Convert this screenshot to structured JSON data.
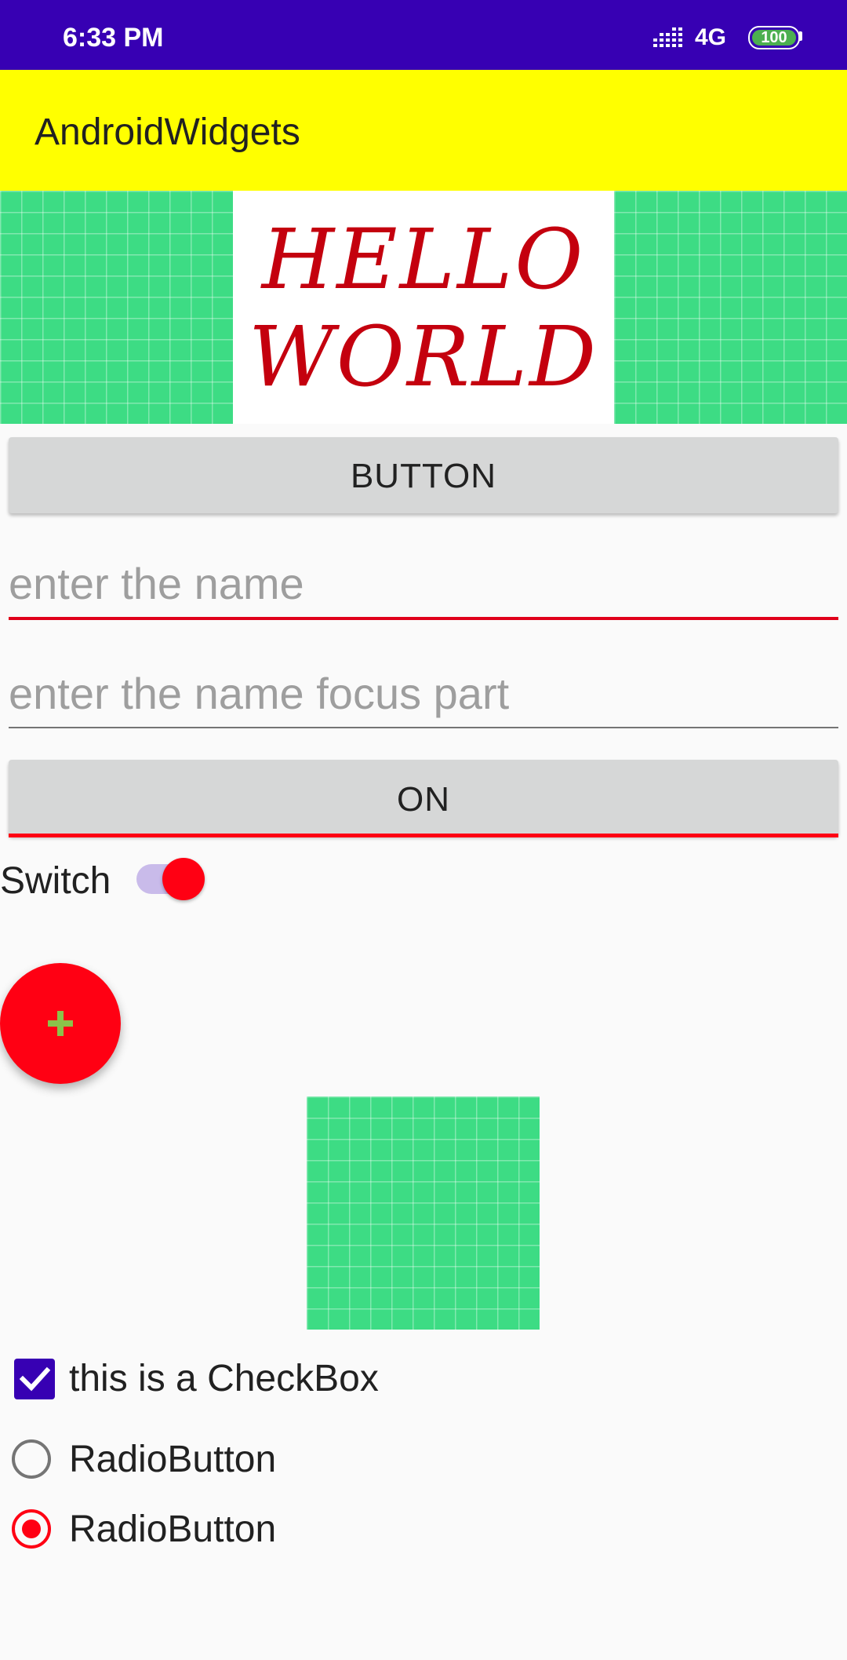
{
  "status_bar": {
    "time": "6:33 PM",
    "network": "4G",
    "battery": "100"
  },
  "toolbar": {
    "title": "AndroidWidgets"
  },
  "banner": {
    "line1": "HELLO",
    "line2": "WORLD"
  },
  "button": {
    "label": "BUTTON"
  },
  "name_input": {
    "placeholder": "enter the name",
    "value": ""
  },
  "focus_input": {
    "placeholder": "enter the name focus part",
    "value": ""
  },
  "toggle_button": {
    "label": "ON",
    "checked": true
  },
  "switch": {
    "label": "Switch",
    "checked": true
  },
  "fab": {
    "icon": "plus-icon",
    "color": "#ff0013",
    "icon_color": "#8bc34a"
  },
  "checkbox": {
    "label": "this is a CheckBox",
    "checked": true
  },
  "radios": [
    {
      "label": "RadioButton",
      "checked": false
    },
    {
      "label": "RadioButton",
      "checked": true
    }
  ],
  "colors": {
    "status_bar": "#3700b3",
    "toolbar": "#ffff00",
    "accent": "#ff0013",
    "primary": "#3700b3",
    "image_green": "#3ddc84"
  }
}
